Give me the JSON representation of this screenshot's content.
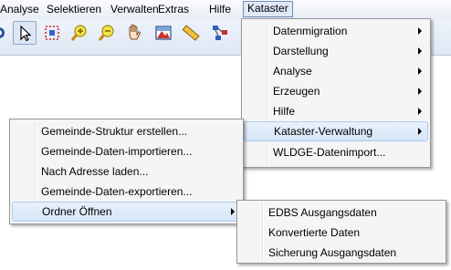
{
  "menubar": {
    "items": [
      "Analyse",
      "Selektieren",
      "Verwalten",
      "Extras",
      "Hilfe",
      "Kataster"
    ]
  },
  "toolbar": {
    "tools": [
      "partial-tool-icon",
      "pointer-select-icon",
      "grid-select-icon",
      "zoom-in-icon",
      "zoom-out-icon",
      "pan-hand-icon",
      "map-image-icon",
      "ruler-icon",
      "network-icon"
    ]
  },
  "kataster_menu": {
    "items": [
      "Datenmigration",
      "Darstellung",
      "Analyse",
      "Erzeugen",
      "Hilfe",
      "Kataster-Verwaltung",
      "WLDGE-Datenimport..."
    ]
  },
  "verwaltung_menu": {
    "items": [
      "Gemeinde-Struktur erstellen...",
      "Gemeinde-Daten-importieren...",
      "Nach Adresse laden...",
      "Gemeinde-Daten-exportieren...",
      "Ordner Öffnen"
    ]
  },
  "ordner_menu": {
    "items": [
      "EDBS Ausgangsdaten",
      "Konvertierte Daten",
      "Sicherung Ausgangsdaten"
    ]
  },
  "colors": {
    "menu_bg": "#f5f5f5",
    "highlight": "#d6e5f7",
    "highlight_border": "#aecbf0",
    "active_menubar": "#dfe9f6"
  }
}
